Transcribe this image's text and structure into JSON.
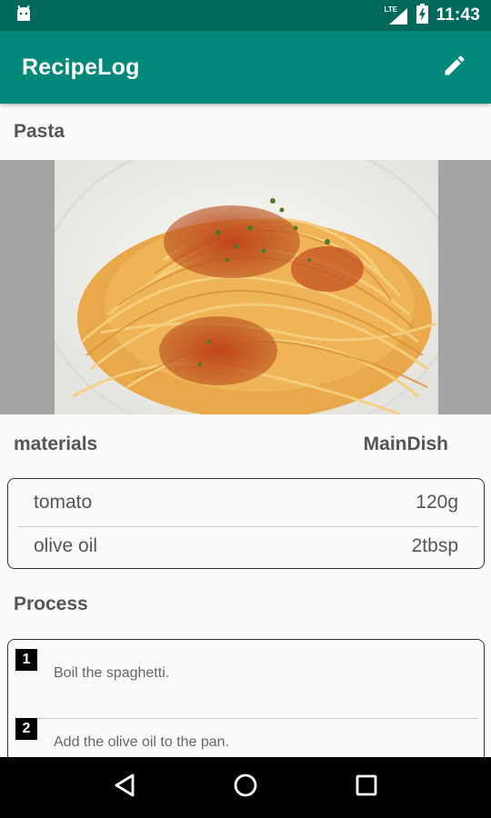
{
  "status_bar": {
    "network": "LTE",
    "time": "11:43"
  },
  "app_bar": {
    "title": "RecipeLog"
  },
  "recipe": {
    "name": "Pasta",
    "materials_label": "materials",
    "category": "MainDish",
    "materials": [
      {
        "name": "tomato",
        "amount": "120g"
      },
      {
        "name": "olive oil",
        "amount": "2tbsp"
      }
    ],
    "process_label": "Process",
    "steps": [
      {
        "number": "1",
        "text": "Boil the spaghetti."
      },
      {
        "number": "2",
        "text": "Add the olive oil to the pan."
      }
    ]
  },
  "icons": {
    "notification": "android-icon",
    "signal": "signal-icon",
    "battery": "battery-charging-icon",
    "edit": "pencil-icon",
    "back": "back-triangle-icon",
    "home": "home-circle-icon",
    "recents": "recents-square-icon"
  },
  "colors": {
    "status_bar": "#00695c",
    "app_bar": "#00897b",
    "background": "#fafafa",
    "text": "#555555"
  }
}
